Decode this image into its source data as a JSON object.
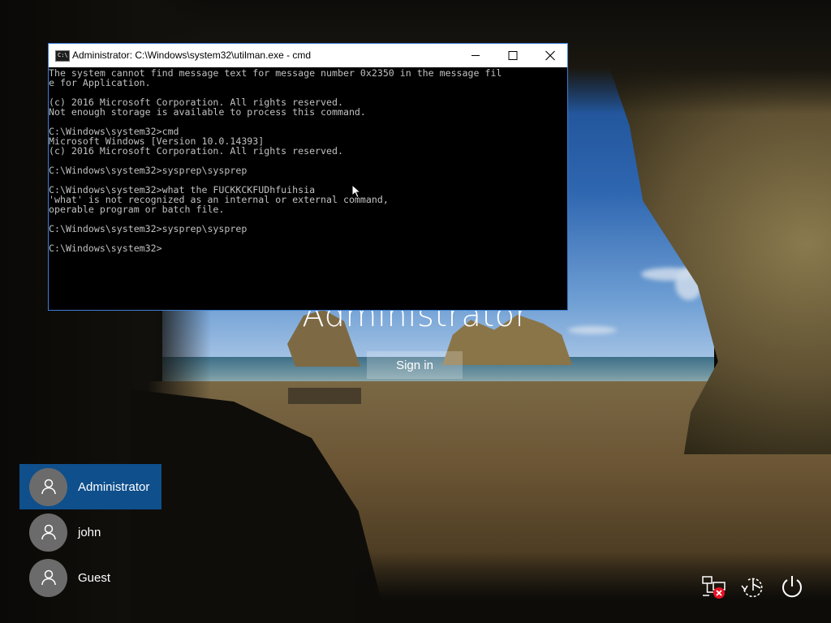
{
  "login": {
    "username": "Administrator",
    "signin_label": "Sign in"
  },
  "users": [
    {
      "label": "Administrator",
      "selected": true
    },
    {
      "label": "john",
      "selected": false
    },
    {
      "label": "Guest",
      "selected": false
    }
  ],
  "system_icons": [
    "network-disconnected-icon",
    "ease-of-access-icon",
    "power-icon"
  ],
  "cmd": {
    "title": "Administrator: C:\\Windows\\system32\\utilman.exe - cmd",
    "lines": [
      "The system cannot find message text for message number 0x2350 in the message fil",
      "e for Application.",
      "",
      "(c) 2016 Microsoft Corporation. All rights reserved.",
      "Not enough storage is available to process this command.",
      "",
      "C:\\Windows\\system32>cmd",
      "Microsoft Windows [Version 10.0.14393]",
      "(c) 2016 Microsoft Corporation. All rights reserved.",
      "",
      "C:\\Windows\\system32>sysprep\\sysprep",
      "",
      "C:\\Windows\\system32>what the FUCKKCKFUDhfuihsia",
      "'what' is not recognized as an internal or external command,",
      "operable program or batch file.",
      "",
      "C:\\Windows\\system32>sysprep\\sysprep",
      "",
      "C:\\Windows\\system32>"
    ]
  },
  "colors": {
    "selected_user_bg": "#0e4f8c",
    "console_text": "#c0c0c0",
    "window_border": "#3c7fd6",
    "error_badge": "#e81123"
  }
}
